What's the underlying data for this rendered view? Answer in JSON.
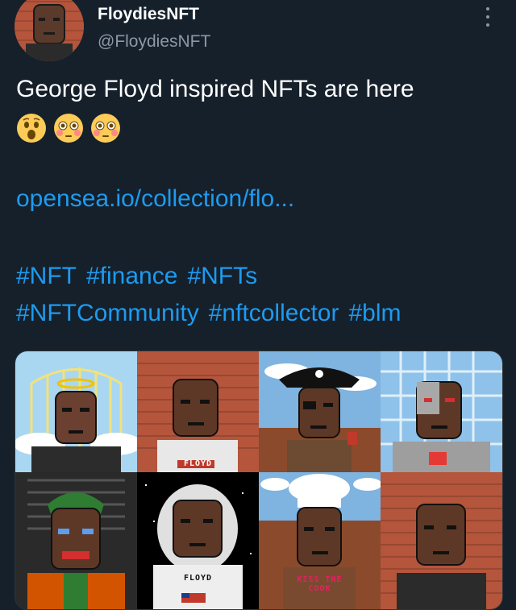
{
  "tweet": {
    "display_name": "FloydiesNFT",
    "handle": "@FloydiesNFT",
    "text": "George Floyd inspired NFTs are here",
    "emojis": [
      "astonished-face",
      "flushed-face",
      "flushed-face"
    ],
    "link": "opensea.io/collection/flo...",
    "hashtags": [
      "#NFT",
      "#finance",
      "#NFTs",
      "#NFTCommunity",
      "#nftcollector",
      "#blm"
    ]
  },
  "media": {
    "tiles": [
      {
        "name": "angel",
        "bg": "#a9d7f2"
      },
      {
        "name": "floyd-shirt",
        "bg": "#b4553c",
        "caption": "FLOYD"
      },
      {
        "name": "pirate",
        "bg": "#7fb3e0"
      },
      {
        "name": "cyborg",
        "bg": "#8ec2ea"
      },
      {
        "name": "joker",
        "bg": "#2a2a2a"
      },
      {
        "name": "astronaut",
        "bg": "#000000",
        "caption": "FLOYD"
      },
      {
        "name": "chef",
        "bg": "#7fb3e0",
        "caption": "KISS THE COOK"
      },
      {
        "name": "plain",
        "bg": "#b4553c"
      }
    ]
  },
  "colors": {
    "background": "#15202b",
    "link": "#1d9bf0",
    "muted": "#8b98a5"
  }
}
